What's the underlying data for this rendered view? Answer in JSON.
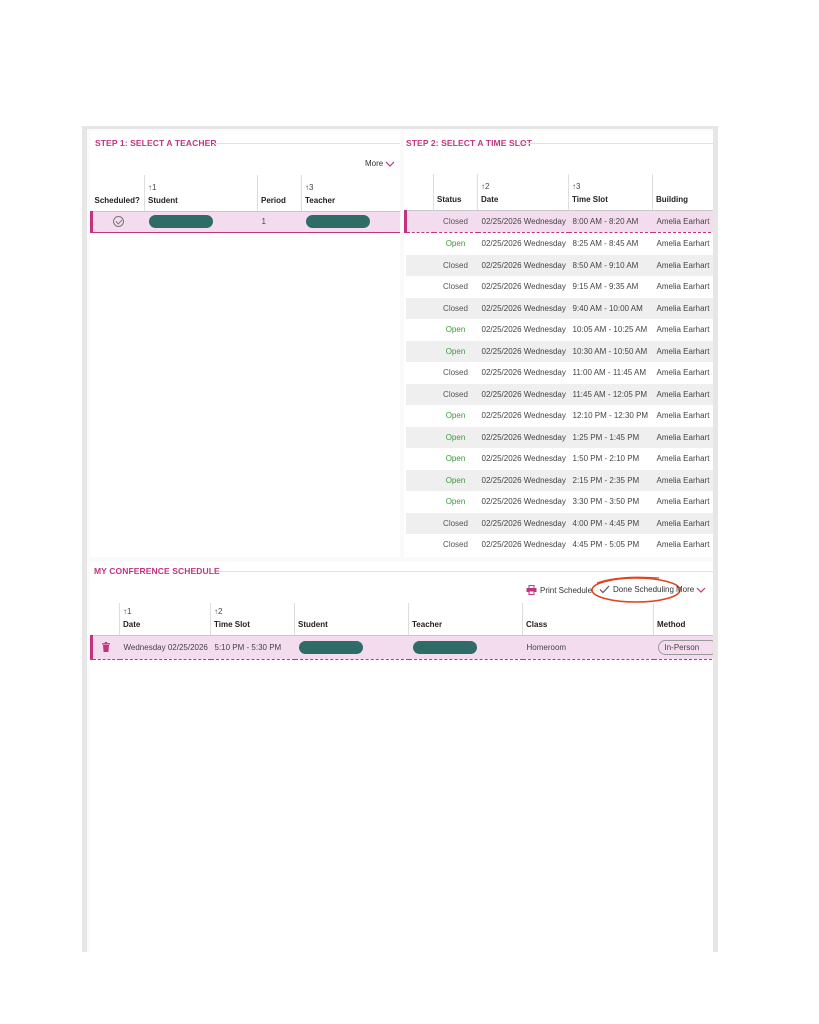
{
  "step1": {
    "title": "STEP 1: SELECT A TEACHER",
    "more_label": "More",
    "columns": [
      {
        "label": "Scheduled?",
        "sort": ""
      },
      {
        "label": "Student",
        "sort": "↑1"
      },
      {
        "label": "Period",
        "sort": ""
      },
      {
        "label": "Teacher",
        "sort": "↑3"
      }
    ],
    "rows": [
      {
        "period": "1"
      }
    ]
  },
  "step2": {
    "title": "STEP 2: SELECT A TIME SLOT",
    "columns": [
      {
        "label": "Status",
        "sort": ""
      },
      {
        "label": "Date",
        "sort": "↑2"
      },
      {
        "label": "Time Slot",
        "sort": "↑3"
      },
      {
        "label": "Building",
        "sort": ""
      }
    ],
    "rows": [
      {
        "status": "Closed",
        "date": "02/25/2026 Wednesday",
        "time": "8:00 AM - 8:20 AM",
        "building": "Amelia Earhart"
      },
      {
        "status": "Open",
        "date": "02/25/2026 Wednesday",
        "time": "8:25 AM - 8:45 AM",
        "building": "Amelia Earhart"
      },
      {
        "status": "Closed",
        "date": "02/25/2026 Wednesday",
        "time": "8:50 AM - 9:10 AM",
        "building": "Amelia Earhart"
      },
      {
        "status": "Closed",
        "date": "02/25/2026 Wednesday",
        "time": "9:15 AM - 9:35 AM",
        "building": "Amelia Earhart"
      },
      {
        "status": "Closed",
        "date": "02/25/2026 Wednesday",
        "time": "9:40 AM - 10:00 AM",
        "building": "Amelia Earhart"
      },
      {
        "status": "Open",
        "date": "02/25/2026 Wednesday",
        "time": "10:05 AM - 10:25 AM",
        "building": "Amelia Earhart"
      },
      {
        "status": "Open",
        "date": "02/25/2026 Wednesday",
        "time": "10:30 AM - 10:50 AM",
        "building": "Amelia Earhart"
      },
      {
        "status": "Closed",
        "date": "02/25/2026 Wednesday",
        "time": "11:00 AM - 11:45 AM",
        "building": "Amelia Earhart"
      },
      {
        "status": "Closed",
        "date": "02/25/2026 Wednesday",
        "time": "11:45 AM - 12:05 PM",
        "building": "Amelia Earhart"
      },
      {
        "status": "Open",
        "date": "02/25/2026 Wednesday",
        "time": "12:10 PM - 12:30 PM",
        "building": "Amelia Earhart"
      },
      {
        "status": "Open",
        "date": "02/25/2026 Wednesday",
        "time": "1:25 PM - 1:45 PM",
        "building": "Amelia Earhart"
      },
      {
        "status": "Open",
        "date": "02/25/2026 Wednesday",
        "time": "1:50 PM - 2:10 PM",
        "building": "Amelia Earhart"
      },
      {
        "status": "Open",
        "date": "02/25/2026 Wednesday",
        "time": "2:15 PM - 2:35 PM",
        "building": "Amelia Earhart"
      },
      {
        "status": "Open",
        "date": "02/25/2026 Wednesday",
        "time": "3:30 PM - 3:50 PM",
        "building": "Amelia Earhart"
      },
      {
        "status": "Closed",
        "date": "02/25/2026 Wednesday",
        "time": "4:00 PM - 4:45 PM",
        "building": "Amelia Earhart"
      },
      {
        "status": "Closed",
        "date": "02/25/2026 Wednesday",
        "time": "4:45 PM - 5:05 PM",
        "building": "Amelia Earhart"
      }
    ]
  },
  "schedule": {
    "title": "MY CONFERENCE SCHEDULE",
    "print_label": "Print Schedule",
    "done_label": "Done Scheduling",
    "more_label": "More",
    "columns": [
      {
        "label": "Date",
        "sort": "↑1"
      },
      {
        "label": "Time Slot",
        "sort": "↑2"
      },
      {
        "label": "Student",
        "sort": ""
      },
      {
        "label": "Teacher",
        "sort": ""
      },
      {
        "label": "Class",
        "sort": ""
      },
      {
        "label": "Method",
        "sort": ""
      }
    ],
    "rows": [
      {
        "date": "Wednesday 02/25/2026",
        "time": "5:10 PM - 5:30 PM",
        "class": "Homeroom",
        "method": "In-Person"
      }
    ]
  },
  "colors": {
    "accent": "#c2347e",
    "open": "#3a9a3a",
    "highlight": "#f4dcef",
    "redacted": "#2f6b67",
    "annotation": "#e2421d"
  }
}
